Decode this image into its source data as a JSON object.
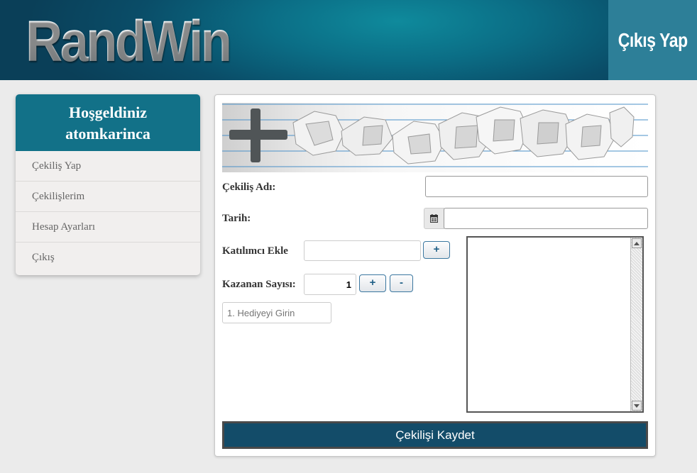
{
  "header": {
    "logo": "RandWin",
    "logout_label": "Çıkış Yap"
  },
  "sidebar": {
    "welcome": "Hoşgeldiniz",
    "username": "atomkarinca",
    "items": [
      {
        "label": "Çekiliş Yap"
      },
      {
        "label": "Çekilişlerim"
      },
      {
        "label": "Hesap Ayarları"
      },
      {
        "label": "Çıkış"
      }
    ]
  },
  "form": {
    "name_label": "Çekiliş Adı:",
    "name_value": "",
    "date_label": "Tarih:",
    "date_value": "",
    "participant_label": "Katılımcı Ekle",
    "participant_value": "",
    "winner_label": "Kazanan Sayısı:",
    "winner_value": "1",
    "plus": "+",
    "minus": "-",
    "gift_placeholder": "1. Hediyeyi Girin",
    "save_label": "Çekilişi Kaydet"
  },
  "colors": {
    "header": "#0a4d68",
    "accent": "#127188",
    "save": "#134c69",
    "logout_bg": "#2d7f98"
  }
}
